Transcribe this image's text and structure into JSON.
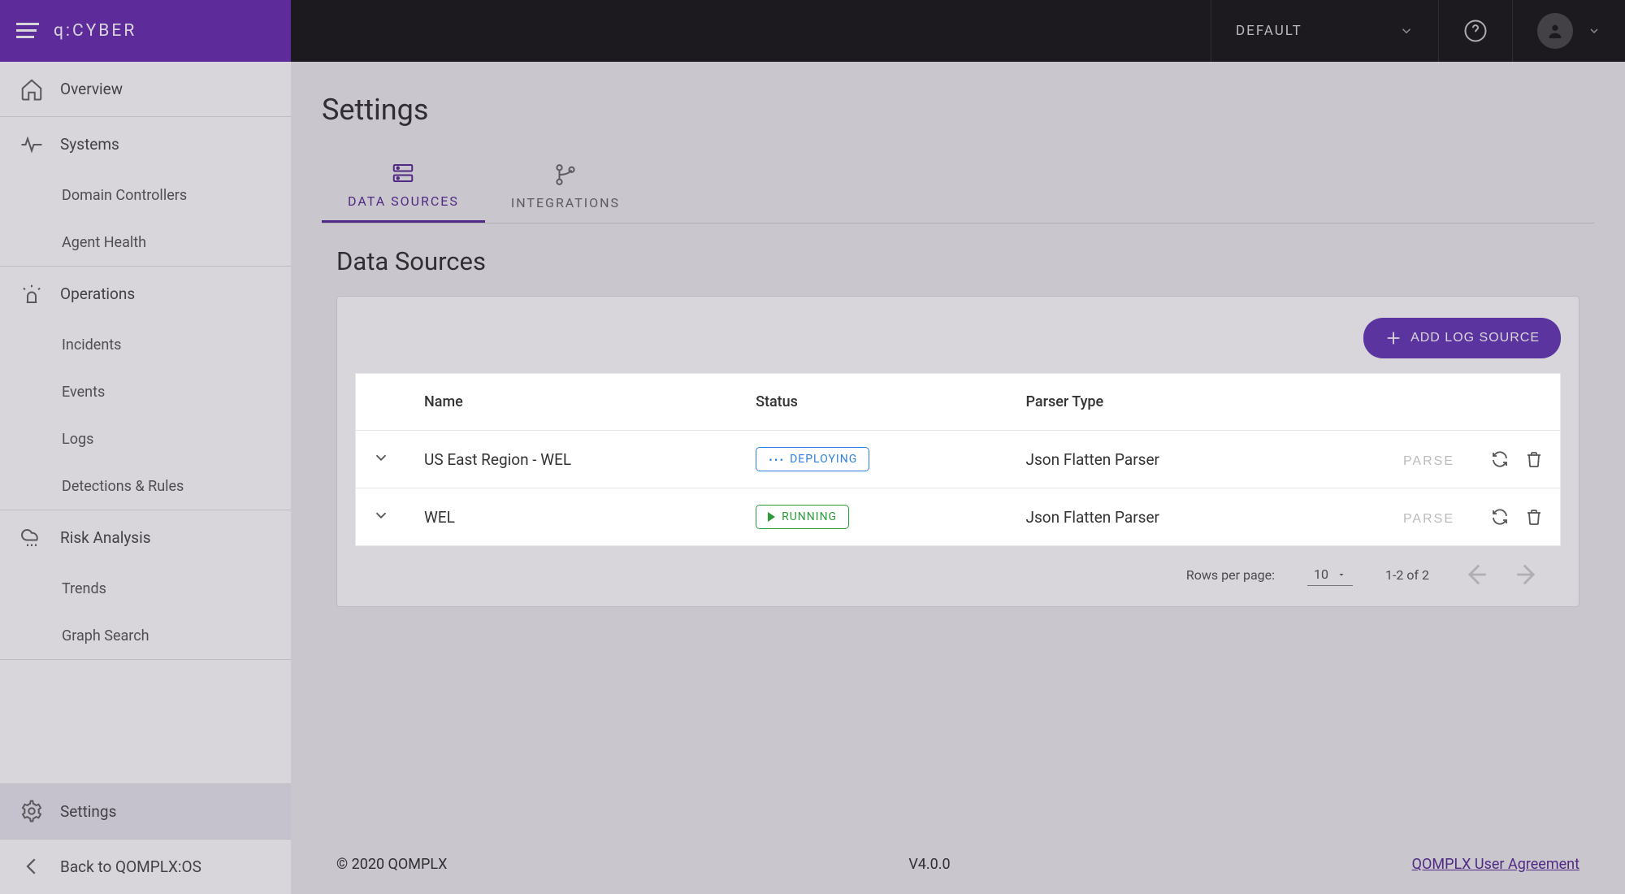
{
  "brand": "q:CYBER",
  "topbar": {
    "env_label": "DEFAULT"
  },
  "sidebar": {
    "items": [
      {
        "label": "Overview"
      },
      {
        "label": "Systems"
      },
      {
        "label": "Domain Controllers"
      },
      {
        "label": "Agent Health"
      },
      {
        "label": "Operations"
      },
      {
        "label": "Incidents"
      },
      {
        "label": "Events"
      },
      {
        "label": "Logs"
      },
      {
        "label": "Detections & Rules"
      },
      {
        "label": "Risk Analysis"
      },
      {
        "label": "Trends"
      },
      {
        "label": "Graph Search"
      }
    ],
    "settings_label": "Settings",
    "back_label": "Back to QOMPLX:OS"
  },
  "page": {
    "title": "Settings",
    "tabs": {
      "data_sources": "DATA SOURCES",
      "integrations": "INTEGRATIONS"
    },
    "section_title": "Data Sources",
    "add_button": "ADD LOG SOURCE"
  },
  "table": {
    "columns": {
      "name": "Name",
      "status": "Status",
      "parser": "Parser Type"
    },
    "rows": [
      {
        "name": "US East Region - WEL",
        "status_label": "DEPLOYING",
        "status_kind": "deploying",
        "parser": "Json Flatten Parser",
        "parse_label": "PARSE"
      },
      {
        "name": "WEL",
        "status_label": "RUNNING",
        "status_kind": "running",
        "parser": "Json Flatten Parser",
        "parse_label": "PARSE"
      }
    ]
  },
  "pager": {
    "rows_label": "Rows per page:",
    "rows_value": "10",
    "range": "1-2 of 2"
  },
  "footer": {
    "copyright": "© 2020 QOMPLX",
    "version": "V4.0.0",
    "link": "QOMPLX User Agreement"
  }
}
